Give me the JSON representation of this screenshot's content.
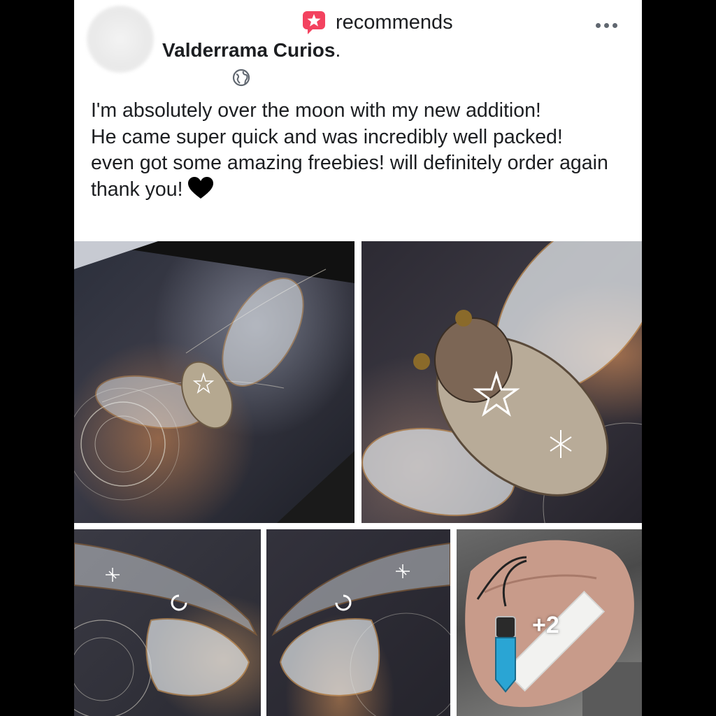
{
  "post": {
    "recommend_label": "recommends",
    "page_name": "Valderrama Curios",
    "page_name_suffix": ".",
    "body_text": "I'm absolutely over the moon with my new addition!\nHe came super quick and was incredibly well packed!\neven got some amazing freebies! will definitely order again\nthank you!",
    "emoji": "black-heart-icon",
    "extra_photos": "+2"
  },
  "colors": {
    "recommend_icon": "#f3425f",
    "text": "#1c1e21",
    "secondary": "#606770"
  },
  "photos": [
    {
      "name": "photo-cicada-frame-1"
    },
    {
      "name": "photo-cicada-closeup"
    },
    {
      "name": "photo-wing-left"
    },
    {
      "name": "photo-wing-right"
    },
    {
      "name": "photo-freebies"
    }
  ]
}
